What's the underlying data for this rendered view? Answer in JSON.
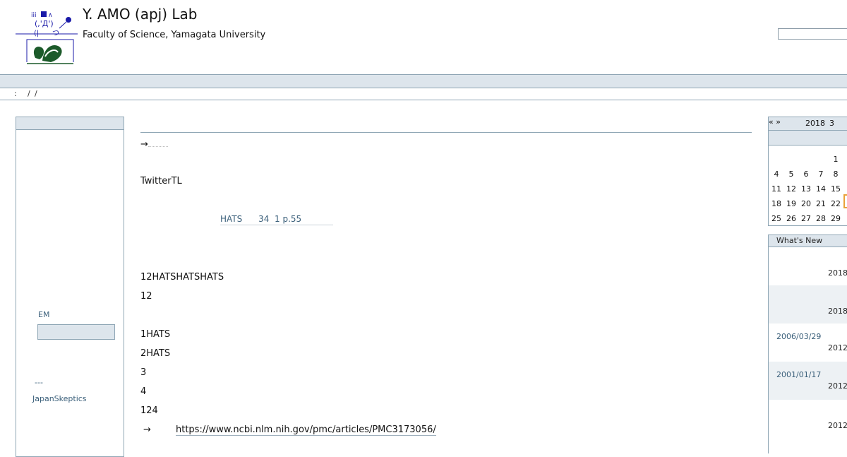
{
  "header": {
    "title": "Y. AMO (apj) Lab",
    "subtitle": "Faculty of Science, Yamagata University",
    "logo_text": "(,'Д')"
  },
  "breadcrumb": [
    ":",
    "/",
    "/"
  ],
  "main": {
    "lines": {
      "arrow": "→",
      "twitter": "TwitterTL",
      "hats_ref": "HATS      34  1 p.55",
      "hats_triple": "12HATSHATSHATS",
      "n12": "12",
      "hats1": "1HATS",
      "hats2": "2HATS",
      "n3": "3",
      "n4": "4",
      "n124": "124",
      "arrow2": "→",
      "ncbi_url": "https://www.ncbi.nlm.nih.gov/pmc/articles/PMC3173056/"
    }
  },
  "left": {
    "em_label": "EM",
    "dash": "---",
    "skeptics": "JapanSkeptics"
  },
  "calendar": {
    "prev": "«",
    "year": "2018",
    "month": "3",
    "next": "»",
    "rows": [
      [
        "",
        "",
        "",
        "",
        "1"
      ],
      [
        "4",
        "5",
        "6",
        "7",
        "8"
      ],
      [
        "11",
        "12",
        "13",
        "14",
        "15"
      ],
      [
        "18",
        "19",
        "20",
        "21",
        "22"
      ],
      [
        "25",
        "26",
        "27",
        "28",
        "29"
      ]
    ],
    "today_color": "#e9a23a"
  },
  "whats_new": {
    "title": "What's New",
    "items": [
      {
        "date": "",
        "year": "2018"
      },
      {
        "date": "",
        "year": "2018"
      },
      {
        "date": "2006/03/29",
        "year": "2012"
      },
      {
        "date": "2001/01/17",
        "year": "2012"
      },
      {
        "date": "",
        "year": "2012"
      }
    ]
  },
  "colors": {
    "accent": "#3a5f7a",
    "bar": "#dde5ec",
    "border": "#8fa6b5"
  }
}
